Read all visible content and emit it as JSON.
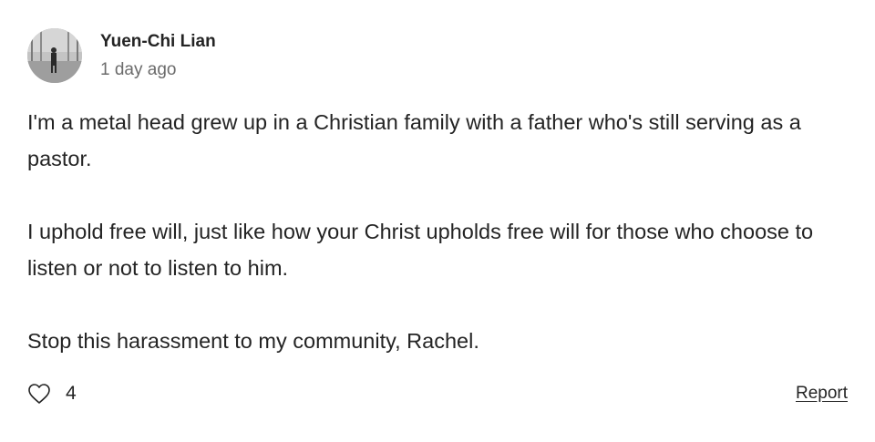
{
  "comment": {
    "author": "Yuen-Chi Lian",
    "time": "1 day ago",
    "avatar_icon": "user-avatar-photo",
    "paragraphs": [
      "I'm a metal head grew up in a Christian family with a father who's still serving as a pastor.",
      "I uphold free will, just like how your Christ upholds free will for those who choose to listen or not to listen to him.",
      "Stop this harassment to my community, Rachel."
    ],
    "like_icon": "heart-icon",
    "likes": "4",
    "report_label": "Report"
  },
  "colors": {
    "text": "#242424",
    "muted": "#6b6b6b",
    "background": "#ffffff"
  }
}
